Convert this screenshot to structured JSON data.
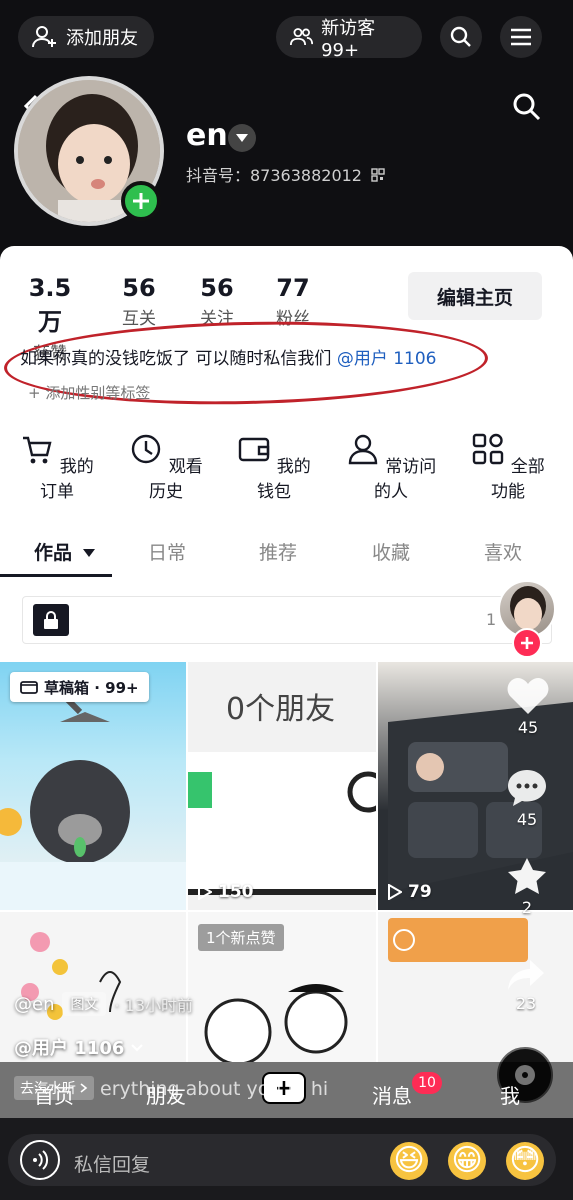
{
  "top": {
    "add_friend": "添加朋友",
    "visitors": "新访客 99+"
  },
  "profile": {
    "name": "en",
    "douyin_id": "抖音号：87363882012"
  },
  "stats": [
    {
      "num": "3.5万",
      "label": "获赞"
    },
    {
      "num": "56",
      "label": "互关"
    },
    {
      "num": "56",
      "label": "关注"
    },
    {
      "num": "77",
      "label": "粉丝"
    }
  ],
  "edit_button": "编辑主页",
  "bio": {
    "text": "如果你真的没钱吃饭了 可以随时私信我们",
    "mention": "@用户 1106"
  },
  "add_tags": "+ 添加性别等标签",
  "functions": [
    {
      "label": "我的订单",
      "icon": "cart-icon"
    },
    {
      "label": "观看历史",
      "icon": "clock-icon"
    },
    {
      "label": "我的钱包",
      "icon": "wallet-icon"
    },
    {
      "label": "常访问的人",
      "icon": "person-icon"
    },
    {
      "label": "全部功能",
      "icon": "grid-icon"
    }
  ],
  "tabs": [
    "作品",
    "日常",
    "推荐",
    "收藏",
    "喜欢"
  ],
  "private_works": {
    "label": "私密作品",
    "count": "1"
  },
  "grid": {
    "draft_badge": "草稿箱 · 99+",
    "friends_overlay": "0个朋友",
    "play_count_2": "150",
    "play_count_3": "79",
    "new_like": "1个新点赞"
  },
  "overlay": {
    "likes": "45",
    "comments": "45",
    "favorites": "2",
    "shares": "23",
    "author": "@en",
    "post_type": "图文",
    "time_ago": "· 13小时前",
    "mention": "@用户 1106",
    "watermark_tag": "去汽水听",
    "marquee": "erything about you in hi"
  },
  "bottom_nav": {
    "home": "首页",
    "friends": "朋友",
    "plus": "+",
    "messages": "消息",
    "messages_badge": "10",
    "me": "我"
  },
  "reply": {
    "placeholder": "私信回复"
  },
  "colors": {
    "accent_red": "#fe2c55",
    "mention_blue": "#1f5fbf",
    "annotation_red": "#c0222a",
    "plus_green": "#2fbf4e"
  }
}
